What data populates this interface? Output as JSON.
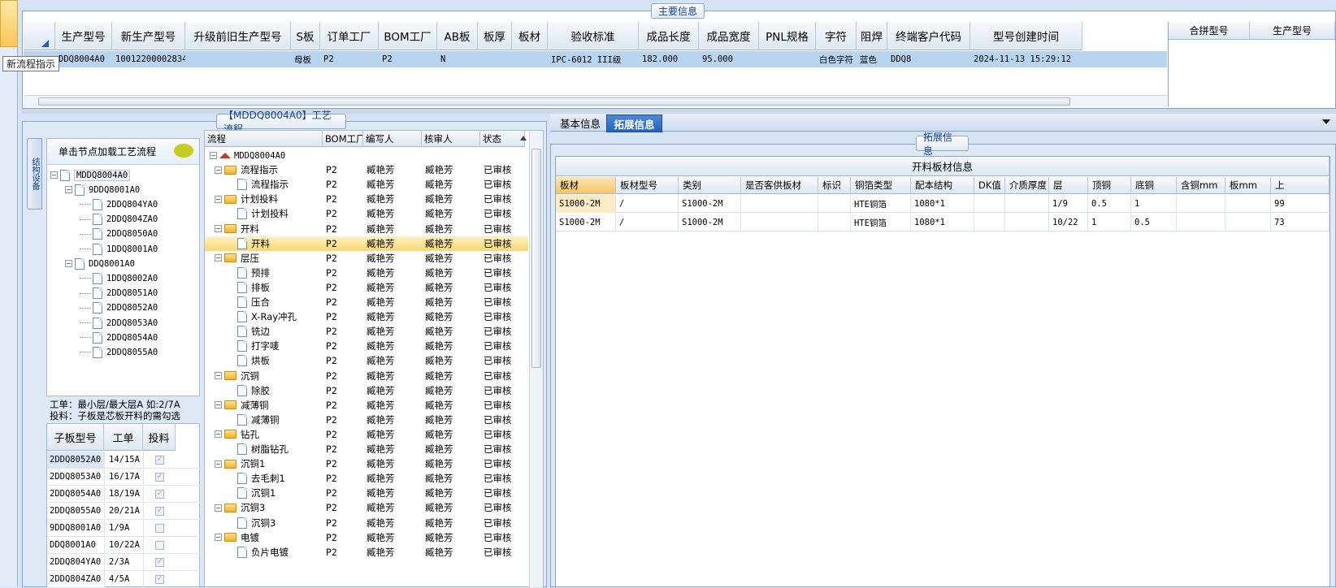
{
  "tooltip": "新流程指示",
  "main": {
    "title": "主要信息",
    "headers": [
      "生产型号",
      "新生产型号",
      "升级前旧生产型号",
      "S板",
      "订单工厂",
      "BOM工厂",
      "AB板",
      "板厚",
      "板材",
      "验收标准",
      "成品长度",
      "成品宽度",
      "PNL规格",
      "字符",
      "阻焊",
      "终端客户代码",
      "型号创建时间"
    ],
    "row": [
      "DDQ8004A0",
      "10012200002834",
      "",
      "母板",
      "P2",
      "P2",
      "N",
      "",
      "",
      "IPC-6012 III级",
      "182.000",
      "95.000",
      "",
      "白色字符",
      "蓝色",
      "DDQ8",
      "2024-11-13 15:29:12"
    ],
    "side_headers": [
      "合拼型号",
      "生产型号"
    ]
  },
  "flow": {
    "title": "【MDDQ8004A0】工艺流程",
    "vtab": "结构设备",
    "hint": "单击节点加载工艺流程",
    "tree": [
      "MDDQ8004A0",
      "9DDQ8001A0",
      "2DDQ804YA0",
      "2DDQ804ZA0",
      "2DDQ8050A0",
      "1DDQ8001A0",
      "DDQ8001A0",
      "1DDQ8002A0",
      "2DDQ8051A0",
      "2DDQ8052A0",
      "2DDQ8053A0",
      "2DDQ8054A0",
      "2DDQ8055A0"
    ],
    "note1": "工单：最小层/最大层A 如:2/7A",
    "note2": "投料：子板是芯板开料的需勾选",
    "sub_headers": [
      "子板型号",
      "工单",
      "投料"
    ],
    "sub_rows": [
      {
        "id": "2DDQ8052A0",
        "wo": "14/15A",
        "checked": true
      },
      {
        "id": "2DDQ8053A0",
        "wo": "16/17A",
        "checked": true
      },
      {
        "id": "2DDQ8054A0",
        "wo": "18/19A",
        "checked": true
      },
      {
        "id": "2DDQ8055A0",
        "wo": "20/21A",
        "checked": true
      },
      {
        "id": "9DDQ8001A0",
        "wo": "1/9A",
        "checked": false
      },
      {
        "id": "DDQ8001A0",
        "wo": "10/22A",
        "checked": false
      },
      {
        "id": "2DDQ804YA0",
        "wo": "2/3A",
        "checked": true
      },
      {
        "id": "2DDQ804ZA0",
        "wo": "4/5A",
        "checked": true
      }
    ],
    "proc_headers": [
      "流程",
      "BOM工厂",
      "编写人",
      "核审人",
      "状态"
    ],
    "root": "MDDQ8004A0",
    "proc_rows": [
      {
        "n": "流程指示",
        "t": "f",
        "b": "P2",
        "w": "臧艳芳",
        "r": "臧艳芳",
        "s": "已审核"
      },
      {
        "n": "流程指示",
        "t": "d",
        "b": "P2",
        "w": "臧艳芳",
        "r": "臧艳芳",
        "s": "已审核"
      },
      {
        "n": "计划投料",
        "t": "f",
        "b": "P2",
        "w": "臧艳芳",
        "r": "臧艳芳",
        "s": "已审核"
      },
      {
        "n": "计划投料",
        "t": "d",
        "b": "P2",
        "w": "臧艳芳",
        "r": "臧艳芳",
        "s": "已审核"
      },
      {
        "n": "开料",
        "t": "f",
        "b": "P2",
        "w": "臧艳芳",
        "r": "臧艳芳",
        "s": "已审核"
      },
      {
        "n": "开料",
        "t": "d",
        "b": "P2",
        "w": "臧艳芳",
        "r": "臧艳芳",
        "s": "已审核",
        "sel": true
      },
      {
        "n": "层压",
        "t": "f",
        "b": "P2",
        "w": "臧艳芳",
        "r": "臧艳芳",
        "s": "已审核"
      },
      {
        "n": "预排",
        "t": "d",
        "b": "P2",
        "w": "臧艳芳",
        "r": "臧艳芳",
        "s": "已审核"
      },
      {
        "n": "排板",
        "t": "d",
        "b": "P2",
        "w": "臧艳芳",
        "r": "臧艳芳",
        "s": "已审核"
      },
      {
        "n": "压合",
        "t": "d",
        "b": "P2",
        "w": "臧艳芳",
        "r": "臧艳芳",
        "s": "已审核"
      },
      {
        "n": "X-Ray冲孔",
        "t": "d",
        "b": "P2",
        "w": "臧艳芳",
        "r": "臧艳芳",
        "s": "已审核"
      },
      {
        "n": "铣边",
        "t": "d",
        "b": "P2",
        "w": "臧艳芳",
        "r": "臧艳芳",
        "s": "已审核"
      },
      {
        "n": "打字唛",
        "t": "d",
        "b": "P2",
        "w": "臧艳芳",
        "r": "臧艳芳",
        "s": "已审核"
      },
      {
        "n": "烘板",
        "t": "d",
        "b": "P2",
        "w": "臧艳芳",
        "r": "臧艳芳",
        "s": "已审核"
      },
      {
        "n": "沉铜",
        "t": "f",
        "b": "P2",
        "w": "臧艳芳",
        "r": "臧艳芳",
        "s": "已审核"
      },
      {
        "n": "除胶",
        "t": "d",
        "b": "P2",
        "w": "臧艳芳",
        "r": "臧艳芳",
        "s": "已审核"
      },
      {
        "n": "减薄铜",
        "t": "f",
        "b": "P2",
        "w": "臧艳芳",
        "r": "臧艳芳",
        "s": "已审核"
      },
      {
        "n": "减薄铜",
        "t": "d",
        "b": "P2",
        "w": "臧艳芳",
        "r": "臧艳芳",
        "s": "已审核"
      },
      {
        "n": "钻孔",
        "t": "f",
        "b": "P2",
        "w": "臧艳芳",
        "r": "臧艳芳",
        "s": "已审核"
      },
      {
        "n": "树脂钻孔",
        "t": "d",
        "b": "P2",
        "w": "臧艳芳",
        "r": "臧艳芳",
        "s": "已审核"
      },
      {
        "n": "沉铜1",
        "t": "f",
        "b": "P2",
        "w": "臧艳芳",
        "r": "臧艳芳",
        "s": "已审核"
      },
      {
        "n": "去毛刺1",
        "t": "d",
        "b": "P2",
        "w": "臧艳芳",
        "r": "臧艳芳",
        "s": "已审核"
      },
      {
        "n": "沉铜1",
        "t": "d",
        "b": "P2",
        "w": "臧艳芳",
        "r": "臧艳芳",
        "s": "已审核"
      },
      {
        "n": "沉铜3",
        "t": "f",
        "b": "P2",
        "w": "臧艳芳",
        "r": "臧艳芳",
        "s": "已审核"
      },
      {
        "n": "沉铜3",
        "t": "d",
        "b": "P2",
        "w": "臧艳芳",
        "r": "臧艳芳",
        "s": "已审核"
      },
      {
        "n": "电镀",
        "t": "f",
        "b": "P2",
        "w": "臧艳芳",
        "r": "臧艳芳",
        "s": "已审核"
      },
      {
        "n": "负片电镀",
        "t": "d",
        "b": "P2",
        "w": "臧艳芳",
        "r": "臧艳芳",
        "s": "已审核"
      }
    ]
  },
  "right": {
    "tabs": [
      "基本信息",
      "拓展信息"
    ],
    "group_title": "拓展信息",
    "table_title": "开料板材信息",
    "headers": [
      "板材",
      "板材型号",
      "类别",
      "是否客供板材",
      "标识",
      "铜箔类型",
      "配本结构",
      "DK值",
      "介质厚度",
      "层",
      "顶铜",
      "底铜",
      "含铜mm",
      "板mm",
      "上"
    ],
    "rows": [
      [
        "S1000-2M",
        "/",
        "S1000-2M",
        "",
        "",
        "HTE铜箔",
        "1080*1",
        "",
        "",
        "1/9",
        "0.5",
        "1",
        "",
        "",
        "99"
      ],
      [
        "S1000-2M",
        "/",
        "S1000-2M",
        "",
        "",
        "HTE铜箔",
        "1080*1",
        "",
        "",
        "10/22",
        "1",
        "0.5",
        "",
        "",
        "73"
      ]
    ]
  }
}
